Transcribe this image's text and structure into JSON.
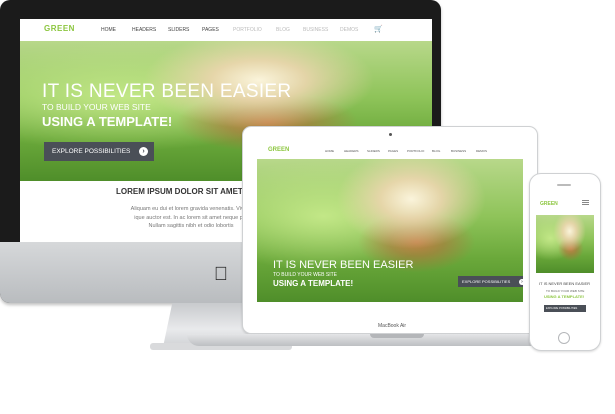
{
  "site": {
    "logo": "GREEN",
    "nav": [
      "HOME",
      "HEADERS",
      "SLIDERS",
      "PAGES",
      "PORTFOLIO",
      "BLOG",
      "BUSINESS",
      "DEMOS"
    ],
    "hero_line1": "IT IS NEVER BEEN EASIER",
    "hero_line2": "TO BUILD YOUR WEB SITE",
    "hero_line3": "USING A TEMPLATE!",
    "cta": "EXPLORE POSSIBILITIES",
    "section_title": "LOREM IPSUM DOLOR SIT AMET, CO",
    "section_body": [
      "Aliquam eu dui et lorem gravida venenatis. Vivam",
      "ique auctor est. In ac lorem sit amet neque pre",
      "Nullam sagittis nibh et odio lobortis"
    ],
    "phone_line1": "IT IS NEVER BEEN EASIER",
    "phone_line2": "TO BUILD YOUR WEB SITE",
    "phone_line3": "USING A TEMPLATE!"
  },
  "devices": {
    "laptop_label": "MacBook Air",
    "apple_icon": "apple-logo-icon"
  },
  "colors": {
    "brand_green": "#8cc63f",
    "button": "#4a4f57",
    "imac_bezel": "#1b1b1b"
  }
}
